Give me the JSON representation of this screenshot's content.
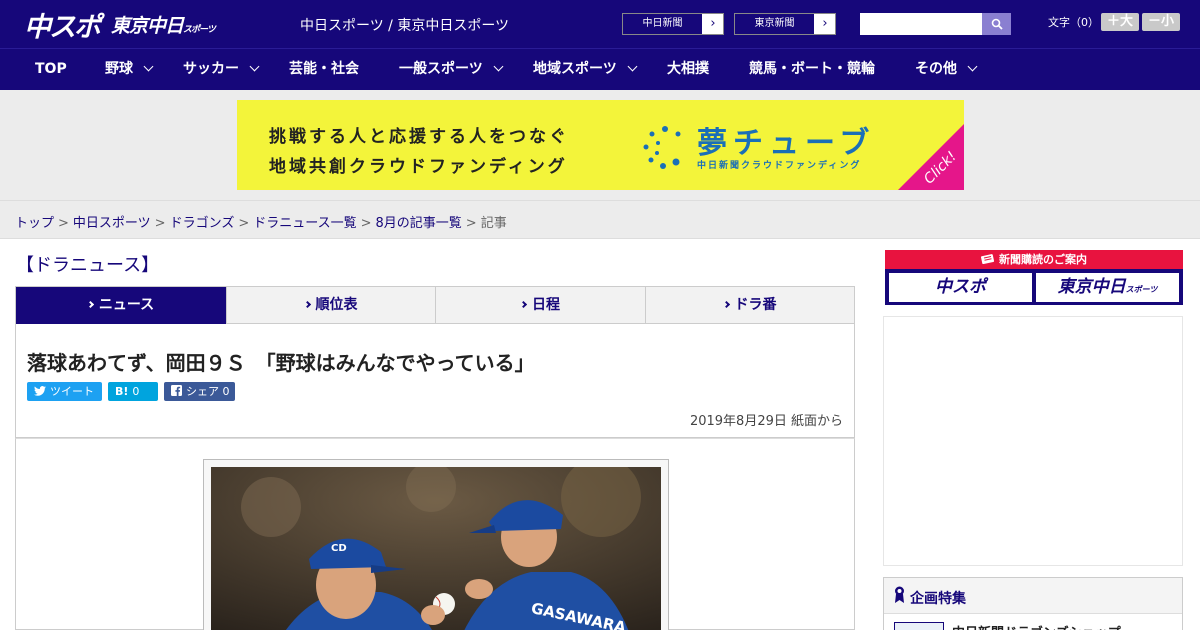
{
  "header": {
    "logo_main": "中スポ",
    "logo_sub": "東京中日",
    "logo_sub_small": "スポーツ",
    "site_links": "中日スポーツ / 東京中日スポーツ",
    "ext_links": [
      {
        "label": "中日新聞",
        "arrow": "›"
      },
      {
        "label": "東京新聞",
        "arrow": "›"
      }
    ],
    "search": {
      "placeholder": "",
      "value": ""
    },
    "font_size_label": "文字（0）",
    "font_increase": "＋大",
    "font_decrease": "－小"
  },
  "nav": {
    "items": [
      {
        "label": "TOP",
        "has_dropdown": false
      },
      {
        "label": "野球",
        "has_dropdown": true
      },
      {
        "label": "サッカー",
        "has_dropdown": true
      },
      {
        "label": "芸能・社会",
        "has_dropdown": false
      },
      {
        "label": "一般スポーツ",
        "has_dropdown": true
      },
      {
        "label": "地域スポーツ",
        "has_dropdown": true
      },
      {
        "label": "大相撲",
        "has_dropdown": false
      },
      {
        "label": "競馬・ボート・競輪",
        "has_dropdown": false
      },
      {
        "label": "その他",
        "has_dropdown": true
      }
    ]
  },
  "ad_banner": {
    "line1": "挑戦する人と応援する人をつなぐ",
    "line2": "地域共創クラウドファンディング",
    "brand": "夢チューブ",
    "brand_sub": "中日新聞クラウドファンディング",
    "click": "Click!"
  },
  "breadcrumb": {
    "links": [
      "トップ",
      "中日スポーツ",
      "ドラゴンズ",
      "ドラニュース一覧",
      "8月の記事一覧"
    ],
    "separator": ">",
    "current": "記事"
  },
  "main": {
    "section_title": "【ドラニュース】",
    "tabs": [
      {
        "label": "ニュース",
        "active": true
      },
      {
        "label": "順位表",
        "active": false
      },
      {
        "label": "日程",
        "active": false
      },
      {
        "label": "ドラ番",
        "active": false
      }
    ],
    "headline": "落球あわてず、岡田９Ｓ　「野球はみんなでやっている」",
    "share": {
      "tweet": "ツイート",
      "hatena_icon": "B!",
      "hatena_count": "0",
      "facebook": "シェア",
      "facebook_count": "0"
    },
    "date": "2019年8月29日 紙面から"
  },
  "sidebar": {
    "subscription_header": "新聞購読のご案内",
    "subscription_buttons": [
      "中スポ",
      "東京中日"
    ],
    "subscription_button_small": "スポーツ",
    "feature_title": "企画特集",
    "feature_item": "中日新聞ドラゴンズショップ"
  },
  "colors": {
    "brand_navy": "#16077a",
    "banner_yellow": "#f3f43a",
    "banner_blue": "#1a6fb7",
    "click_pink": "#e5168a",
    "subscription_red": "#e8133f",
    "twitter": "#1da1f2",
    "hatena": "#00a4de",
    "facebook": "#3b5998"
  }
}
